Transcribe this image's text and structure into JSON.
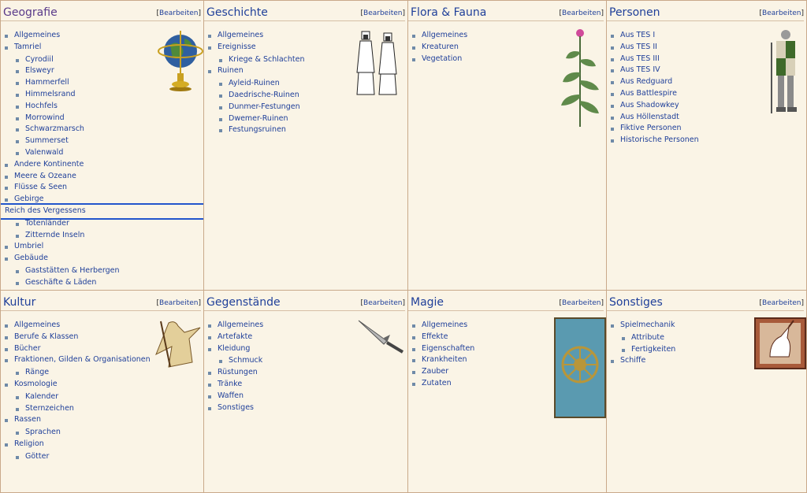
{
  "edit_label": "Bearbeiten",
  "panels": {
    "geografie": {
      "title": "Geografie",
      "items": [
        {
          "label": "Allgemeines"
        },
        {
          "label": "Tamriel",
          "children": [
            "Cyrodiil",
            "Elsweyr",
            "Hammerfell",
            "Himmelsrand",
            "Hochfels",
            "Morrowind",
            "Schwarzmarsch",
            "Summerset",
            "Valenwald"
          ]
        },
        {
          "label": "Andere Kontinente"
        },
        {
          "label": "Meere & Ozeane"
        },
        {
          "label": "Flüsse & Seen"
        },
        {
          "label": "Gebirge"
        },
        {
          "label": "Reich des Vergessens",
          "highlight": true,
          "children": [
            "Totenländer",
            "Zitternde Inseln"
          ]
        },
        {
          "label": "Umbriel"
        },
        {
          "label": "Gebäude",
          "children": [
            "Gaststätten & Herbergen",
            "Geschäfte & Läden"
          ]
        }
      ],
      "icon": "globe-icon"
    },
    "geschichte": {
      "title": "Geschichte",
      "items": [
        {
          "label": "Allgemeines"
        },
        {
          "label": "Ereignisse",
          "children": [
            "Kriege & Schlachten"
          ]
        },
        {
          "label": "Ruinen",
          "children": [
            "Ayleid-Ruinen",
            "Daedrische-Ruinen",
            "Dunmer-Festungen",
            "Dwemer-Ruinen",
            "Festungsruinen"
          ]
        }
      ],
      "icon": "figures-icon"
    },
    "flora": {
      "title": "Flora & Fauna",
      "items": [
        {
          "label": "Allgemeines"
        },
        {
          "label": "Kreaturen"
        },
        {
          "label": "Vegetation"
        }
      ],
      "icon": "plant-icon"
    },
    "personen": {
      "title": "Personen",
      "items": [
        {
          "label": "Aus TES I"
        },
        {
          "label": "Aus TES II"
        },
        {
          "label": "Aus TES III"
        },
        {
          "label": "Aus TES IV"
        },
        {
          "label": "Aus Redguard"
        },
        {
          "label": "Aus Battlespire"
        },
        {
          "label": "Aus Shadowkey"
        },
        {
          "label": "Aus Höllenstadt"
        },
        {
          "label": "Fiktive Personen"
        },
        {
          "label": "Historische Personen"
        }
      ],
      "icon": "knight-icon"
    },
    "kultur": {
      "title": "Kultur",
      "items": [
        {
          "label": "Allgemeines"
        },
        {
          "label": "Berufe & Klassen"
        },
        {
          "label": "Bücher"
        },
        {
          "label": "Fraktionen, Gilden & Organisationen",
          "children": [
            "Ränge"
          ]
        },
        {
          "label": "Kosmologie",
          "children": [
            "Kalender",
            "Sternzeichen"
          ]
        },
        {
          "label": "Rassen",
          "children": [
            "Sprachen"
          ]
        },
        {
          "label": "Religion",
          "children": [
            "Götter"
          ]
        }
      ],
      "icon": "wizard-icon"
    },
    "gegenstaende": {
      "title": "Gegenstände",
      "items": [
        {
          "label": "Allgemeines"
        },
        {
          "label": "Artefakte"
        },
        {
          "label": "Kleidung",
          "children": [
            "Schmuck"
          ]
        },
        {
          "label": "Rüstungen"
        },
        {
          "label": "Tränke"
        },
        {
          "label": "Waffen"
        },
        {
          "label": "Sonstiges"
        }
      ],
      "icon": "dagger-icon"
    },
    "magie": {
      "title": "Magie",
      "items": [
        {
          "label": "Allgemeines"
        },
        {
          "label": "Effekte"
        },
        {
          "label": "Eigenschaften"
        },
        {
          "label": "Krankheiten"
        },
        {
          "label": "Zauber"
        },
        {
          "label": "Zutaten"
        }
      ],
      "icon": "banner-icon"
    },
    "sonstiges": {
      "title": "Sonstiges",
      "items": [
        {
          "label": "Spielmechanik",
          "children": [
            "Attribute",
            "Fertigkeiten"
          ]
        },
        {
          "label": "Schiffe"
        }
      ],
      "icon": "unicorn-icon"
    }
  },
  "colors": {
    "link": "#20409a",
    "visited": "#5a3a8a",
    "bg": "#faf4e6",
    "border": "#c9a98a"
  }
}
